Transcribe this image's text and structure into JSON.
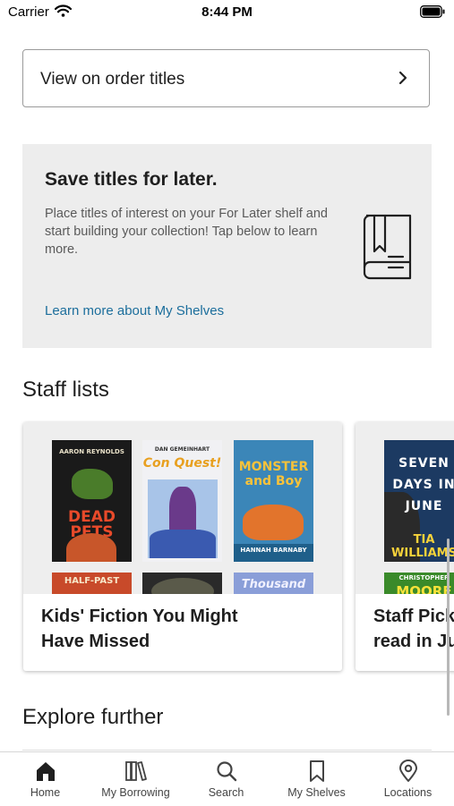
{
  "status_bar": {
    "carrier": "Carrier",
    "time": "8:44 PM"
  },
  "order_button": {
    "label": "View on order titles"
  },
  "promo": {
    "title": "Save titles for later.",
    "body": "Place titles of interest on your For Later shelf and start building your collection! Tap below to learn more.",
    "link": "Learn more about My Shelves"
  },
  "staff_lists": {
    "heading": "Staff lists",
    "cards": [
      {
        "title_line1": "Kids' Fiction You Might",
        "title_line2": "Have Missed",
        "covers": [
          {
            "top_text": "AARON REYNOLDS",
            "main_text": "DEAD PETS"
          },
          {
            "top_text": "DAN GEMEINHART",
            "main_text": "Con Quest!"
          },
          {
            "top_text": "",
            "main_text": "MONSTER and Boy",
            "bottom_text": "HANNAH BARNABY"
          },
          {
            "top_text": "",
            "main_text": "HALF-PAST"
          },
          {
            "top_text": "",
            "main_text": ""
          },
          {
            "top_text": "",
            "main_text": "Thousand"
          }
        ]
      },
      {
        "title_line1": "Staff Pick",
        "title_line2": "read in Ju",
        "covers": [
          {
            "top_text": "SEVEN DAYS IN JUNE",
            "main_text": "TIA WILLIAMS"
          },
          {
            "top_text": "CHRISTOPHER",
            "main_text": "MOORE"
          }
        ]
      }
    ]
  },
  "explore": {
    "heading": "Explore further"
  },
  "tab_bar": {
    "tabs": [
      {
        "label": "Home",
        "icon": "home-icon"
      },
      {
        "label": "My Borrowing",
        "icon": "books-icon"
      },
      {
        "label": "Search",
        "icon": "search-icon"
      },
      {
        "label": "My Shelves",
        "icon": "bookmark-icon"
      },
      {
        "label": "Locations",
        "icon": "location-pin-icon"
      }
    ]
  },
  "colors": {
    "link": "#1c6e9c",
    "promo_bg": "#ededed",
    "text": "#1f1f1f"
  }
}
